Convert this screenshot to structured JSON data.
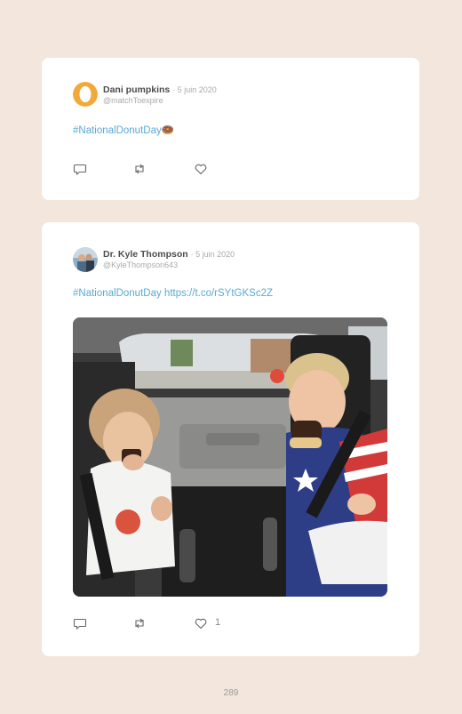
{
  "tweets": [
    {
      "author": "Dani pumpkins",
      "date": "· 5 juin 2020",
      "handle": "@matchToexpire",
      "text": "#NationalDonutDay",
      "emoji": "🍩",
      "likes": ""
    },
    {
      "author": "Dr. Kyle Thompson",
      "date": "· 5 juin 2020",
      "handle": "@KyleThompson643",
      "text": "#NationalDonutDay https://t.co/rSYtGKSc2Z",
      "likes": "1"
    }
  ],
  "page_number": "289",
  "icons": {
    "reply": "reply-icon",
    "retweet": "retweet-icon",
    "like": "heart-icon"
  },
  "colors": {
    "background": "#f3e6dc",
    "card": "#ffffff",
    "link": "#5aa9d6",
    "avatar_ring": "#f2a93b"
  }
}
